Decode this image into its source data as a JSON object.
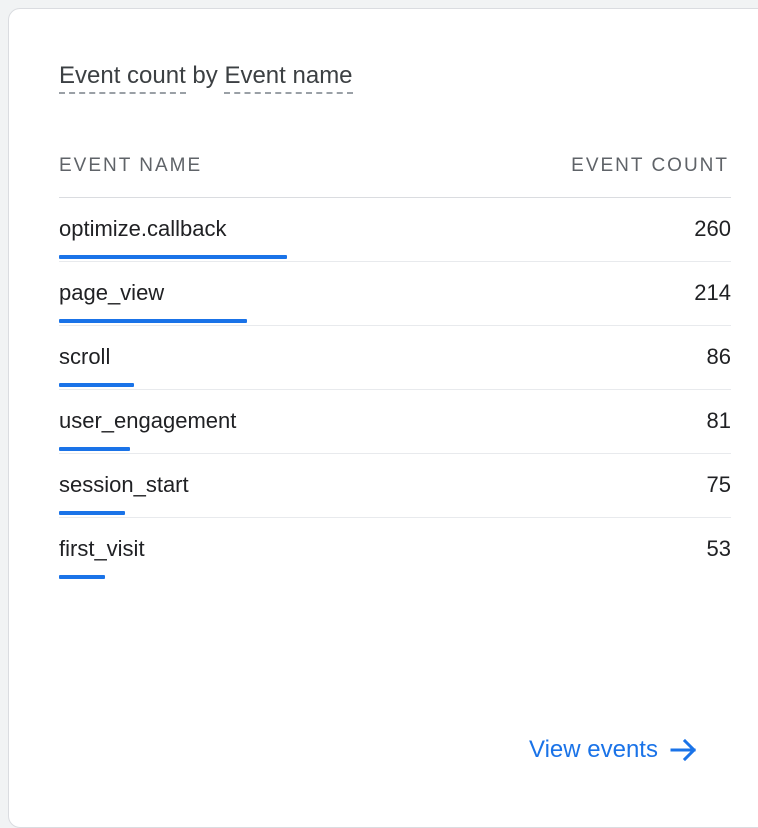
{
  "card": {
    "title_metric": "Event count",
    "title_joiner": "by",
    "title_dimension": "Event name"
  },
  "table": {
    "column_name": "EVENT NAME",
    "column_count": "EVENT COUNT",
    "max_count": 260,
    "rows": [
      {
        "name": "optimize.callback",
        "count": "260",
        "value": 260
      },
      {
        "name": "page_view",
        "count": "214",
        "value": 214
      },
      {
        "name": "scroll",
        "count": "86",
        "value": 86
      },
      {
        "name": "user_engagement",
        "count": "81",
        "value": 81
      },
      {
        "name": "session_start",
        "count": "75",
        "value": 75
      },
      {
        "name": "first_visit",
        "count": "53",
        "value": 53
      }
    ]
  },
  "footer": {
    "link_label": "View events",
    "link_icon": "arrow-right-icon"
  },
  "colors": {
    "accent": "#1a73e8",
    "text": "#202124",
    "muted": "#5f6368",
    "divider": "#e8eaed"
  }
}
